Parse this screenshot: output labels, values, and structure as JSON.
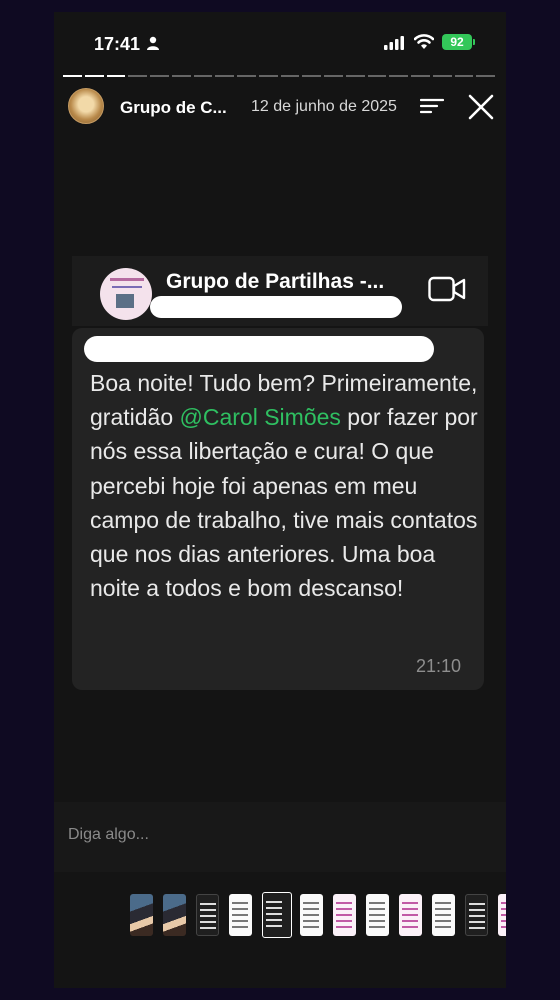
{
  "status_bar": {
    "time": "17:41",
    "battery": "92",
    "icons": [
      "person-icon",
      "signal-icon",
      "wifi-icon",
      "battery-icon"
    ]
  },
  "story": {
    "title": "Grupo de C...",
    "date": "12 de junho de 2025",
    "progress_segments": 20,
    "progress_done": 3
  },
  "chat": {
    "group_name": "Grupo de Partilhas -...",
    "message_before": "Boa noite! Tudo bem? Primeiramente, gratidão ",
    "mention": "@Carol Simões",
    "message_after": " por fazer por nós essa libertação e cura! O que percebi hoje foi apenas em meu campo de trabalho, tive mais contatos que nos dias anteriores. Uma boa noite a todos e bom descanso!",
    "time": "21:10"
  },
  "reply": {
    "placeholder": "Diga algo..."
  },
  "thumbnails": [
    "photo",
    "photo",
    "dark",
    "light",
    "dark-selected",
    "light",
    "pink",
    "light",
    "pink",
    "light",
    "dark",
    "pink"
  ],
  "colors": {
    "mention": "#2fbf61",
    "battery": "#33c759",
    "background": "#0f0a22"
  }
}
